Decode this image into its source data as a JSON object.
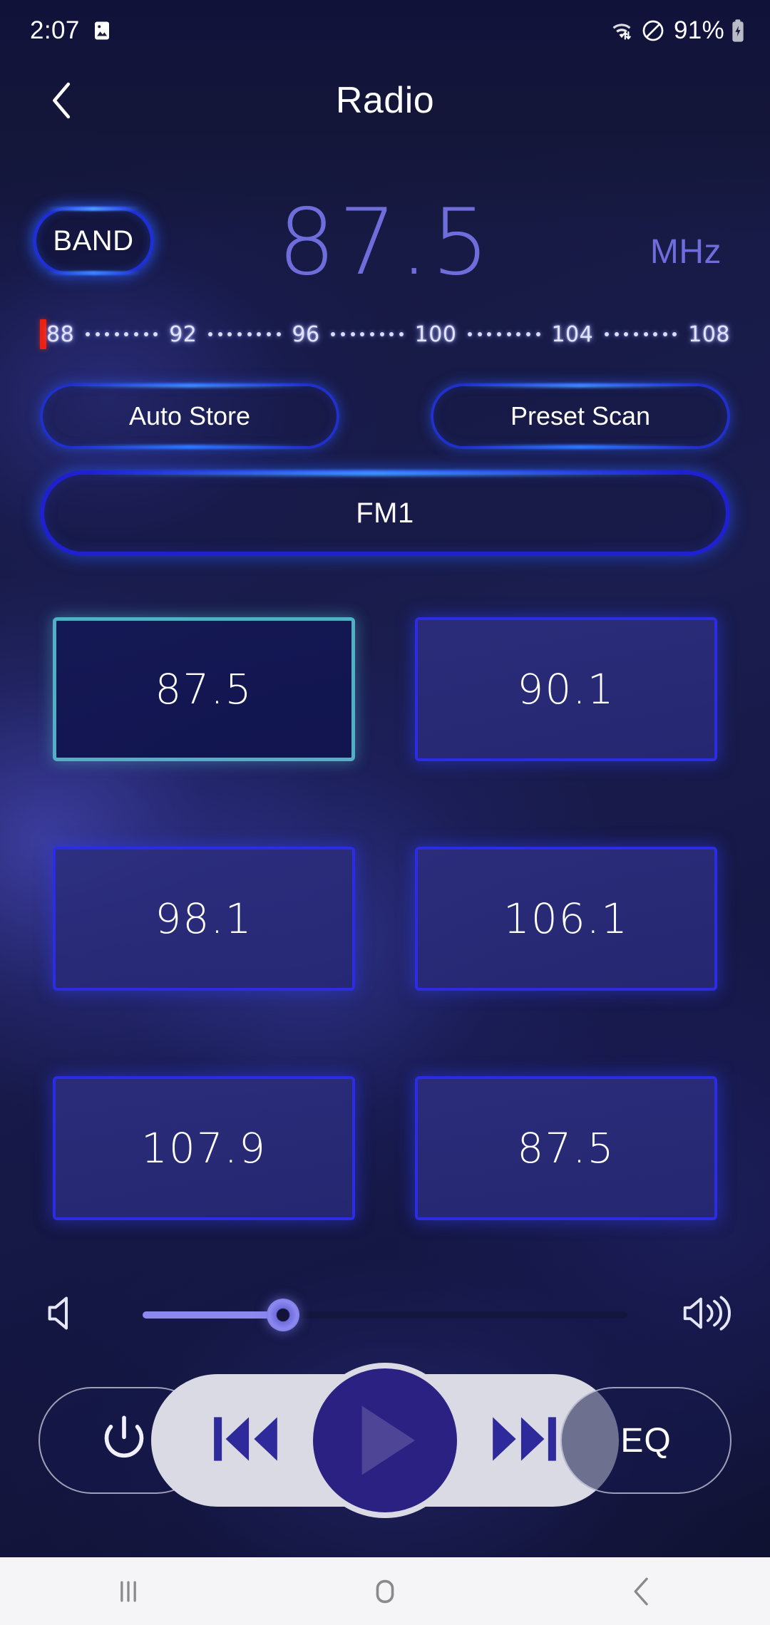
{
  "status_bar": {
    "time": "2:07",
    "battery_percent": "91%",
    "icons": {
      "gallery": "image-icon",
      "wifi": "wifi-transfer-icon",
      "dnd": "do-not-disturb-icon",
      "battery": "battery-charging-icon"
    }
  },
  "header": {
    "title": "Radio",
    "back_icon": "chevron-left-icon"
  },
  "tuner": {
    "band_button_label": "BAND",
    "frequency": "87.5",
    "unit": "MHz"
  },
  "scale": {
    "marker_color": "#f02010",
    "ticks": [
      "88",
      "92",
      "96",
      "100",
      "104",
      "108"
    ],
    "dots_per_gap": 8
  },
  "actions": {
    "auto_store_label": "Auto Store",
    "preset_scan_label": "Preset Scan"
  },
  "band_selector": {
    "label": "FM1"
  },
  "presets": [
    {
      "label": "87.5",
      "selected": true
    },
    {
      "label": "90.1",
      "selected": false
    },
    {
      "label": "98.1",
      "selected": false
    },
    {
      "label": "106.1",
      "selected": false
    },
    {
      "label": "107.9",
      "selected": false
    },
    {
      "label": "87.5",
      "selected": false
    }
  ],
  "volume": {
    "mute_icon": "volume-mute-icon",
    "max_icon": "volume-high-icon",
    "level_percent": 29
  },
  "transport": {
    "power_icon": "power-icon",
    "previous_icon": "previous-track-icon",
    "play_icon": "play-icon",
    "next_icon": "next-track-icon",
    "eq_label": "EQ"
  },
  "nav_bar": {
    "recents_icon": "recents-icon",
    "home_icon": "home-icon",
    "back_icon": "back-icon"
  },
  "colors": {
    "accent_blue": "#2c2ce4",
    "selected_cyan": "#52b0c6",
    "frequency_purple": "#6f6ddc",
    "marker_red": "#f02010",
    "media_pill": "#d9dae4",
    "play_circle": "#2a2183"
  }
}
